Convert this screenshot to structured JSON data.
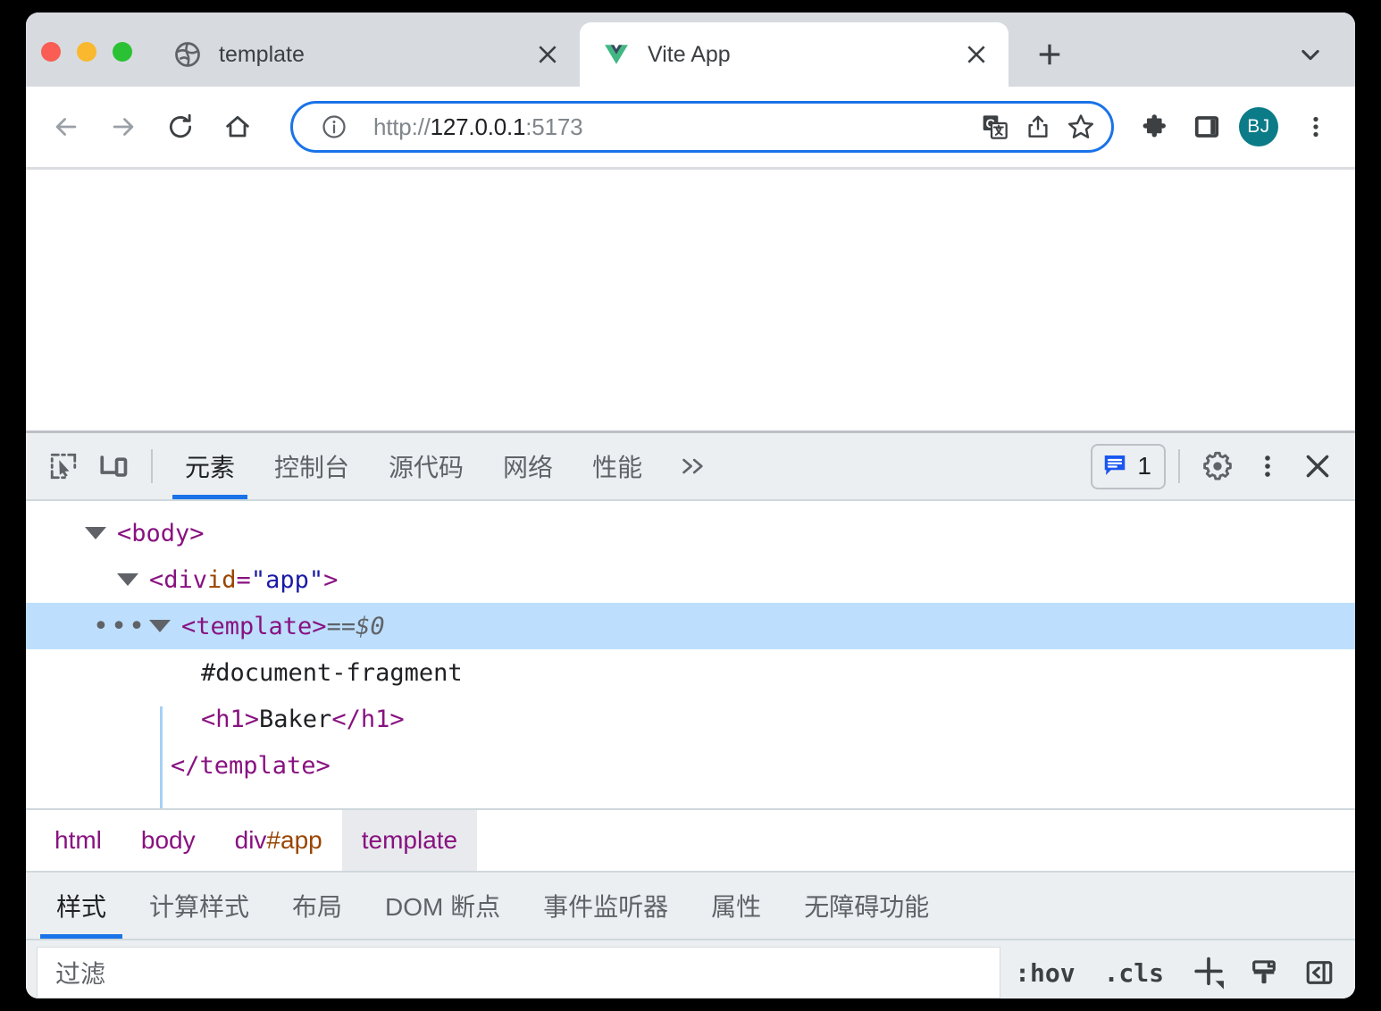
{
  "window": {
    "traffic_lights": [
      "close",
      "minimize",
      "zoom"
    ]
  },
  "tabs": [
    {
      "title": "template",
      "favicon": "globe-icon",
      "active": false
    },
    {
      "title": "Vite App",
      "favicon": "vue-logo-icon",
      "active": true
    }
  ],
  "tabstrip": {
    "new_tab_label": "+",
    "tab_list_icon": "chevron-down-icon"
  },
  "toolbar": {
    "back_icon": "back-arrow-icon",
    "forward_icon": "forward-arrow-icon",
    "reload_icon": "reload-icon",
    "home_icon": "home-icon",
    "site_info_icon": "info-circle-icon",
    "url_scheme": "http://",
    "url_host": "127.0.0.1",
    "url_port": ":5173",
    "url_full": "http://127.0.0.1:5173",
    "translate_icon": "translate-icon",
    "share_icon": "share-icon",
    "bookmark_icon": "star-icon",
    "extensions_icon": "puzzle-icon",
    "side_panel_icon": "side-panel-icon",
    "avatar_initials": "BJ",
    "avatar_color": "#0b7b88",
    "menu_icon": "three-dot-menu-icon",
    "accent_color": "#1a73e8"
  },
  "devtools": {
    "inspect_icon": "inspect-element-icon",
    "device_toolbar_icon": "device-toolbar-icon",
    "tabs": [
      {
        "label": "元素",
        "active": true
      },
      {
        "label": "控制台",
        "active": false
      },
      {
        "label": "源代码",
        "active": false
      },
      {
        "label": "网络",
        "active": false
      },
      {
        "label": "性能",
        "active": false
      }
    ],
    "more_tabs_icon": "double-chevron-right-icon",
    "message_badge": {
      "icon": "message-bubble-icon",
      "count": "1",
      "color": "#1a56f0"
    },
    "settings_icon": "gear-icon",
    "more_icon": "three-dot-menu-icon",
    "close_icon": "close-icon",
    "dom_tree": [
      {
        "indent": 0,
        "arrow": true,
        "parts": [
          {
            "t": "tag",
            "s": "<body>"
          }
        ]
      },
      {
        "indent": 1,
        "arrow": true,
        "parts": [
          {
            "t": "tag",
            "s": "<div "
          },
          {
            "t": "attrname",
            "s": "id"
          },
          {
            "t": "tag",
            "s": "="
          },
          {
            "t": "attrval",
            "s": "\"app\""
          },
          {
            "t": "tag",
            "s": ">"
          }
        ]
      },
      {
        "indent": 2,
        "arrow": true,
        "selected": true,
        "gutter": "•••",
        "parts": [
          {
            "t": "tag",
            "s": "<template>"
          },
          {
            "t": "eqsel",
            "s": " == "
          },
          {
            "t": "dollar",
            "s": "$0"
          }
        ]
      },
      {
        "indent": 3,
        "arrow": false,
        "parts": [
          {
            "t": "plain",
            "s": "#document-fragment"
          }
        ]
      },
      {
        "indent": 3,
        "arrow": false,
        "parts": [
          {
            "t": "tag",
            "s": "<h1>"
          },
          {
            "t": "plain",
            "s": "Baker"
          },
          {
            "t": "tag",
            "s": "</h1>"
          }
        ]
      },
      {
        "indent": 2,
        "arrow": false,
        "parts": [
          {
            "t": "tag",
            "s": "</template>"
          }
        ]
      }
    ],
    "breadcrumbs": [
      {
        "label": "html",
        "selected": false
      },
      {
        "label": "body",
        "selected": false
      },
      {
        "label": "div",
        "hash": "#app",
        "selected": false
      },
      {
        "label": "template",
        "selected": true
      }
    ],
    "styles_tabs": [
      {
        "label": "样式",
        "active": true
      },
      {
        "label": "计算样式",
        "active": false
      },
      {
        "label": "布局",
        "active": false
      },
      {
        "label": "DOM 断点",
        "active": false
      },
      {
        "label": "事件监听器",
        "active": false
      },
      {
        "label": "属性",
        "active": false
      },
      {
        "label": "无障碍功能",
        "active": false
      }
    ],
    "filter": {
      "placeholder": "过滤",
      "value": "",
      "hov_label": ":hov",
      "cls_label": ".cls",
      "new_rule_icon": "plus-icon",
      "computed_icon": "brush-icon",
      "toggle_pane_icon": "toggle-sidebar-icon"
    }
  }
}
